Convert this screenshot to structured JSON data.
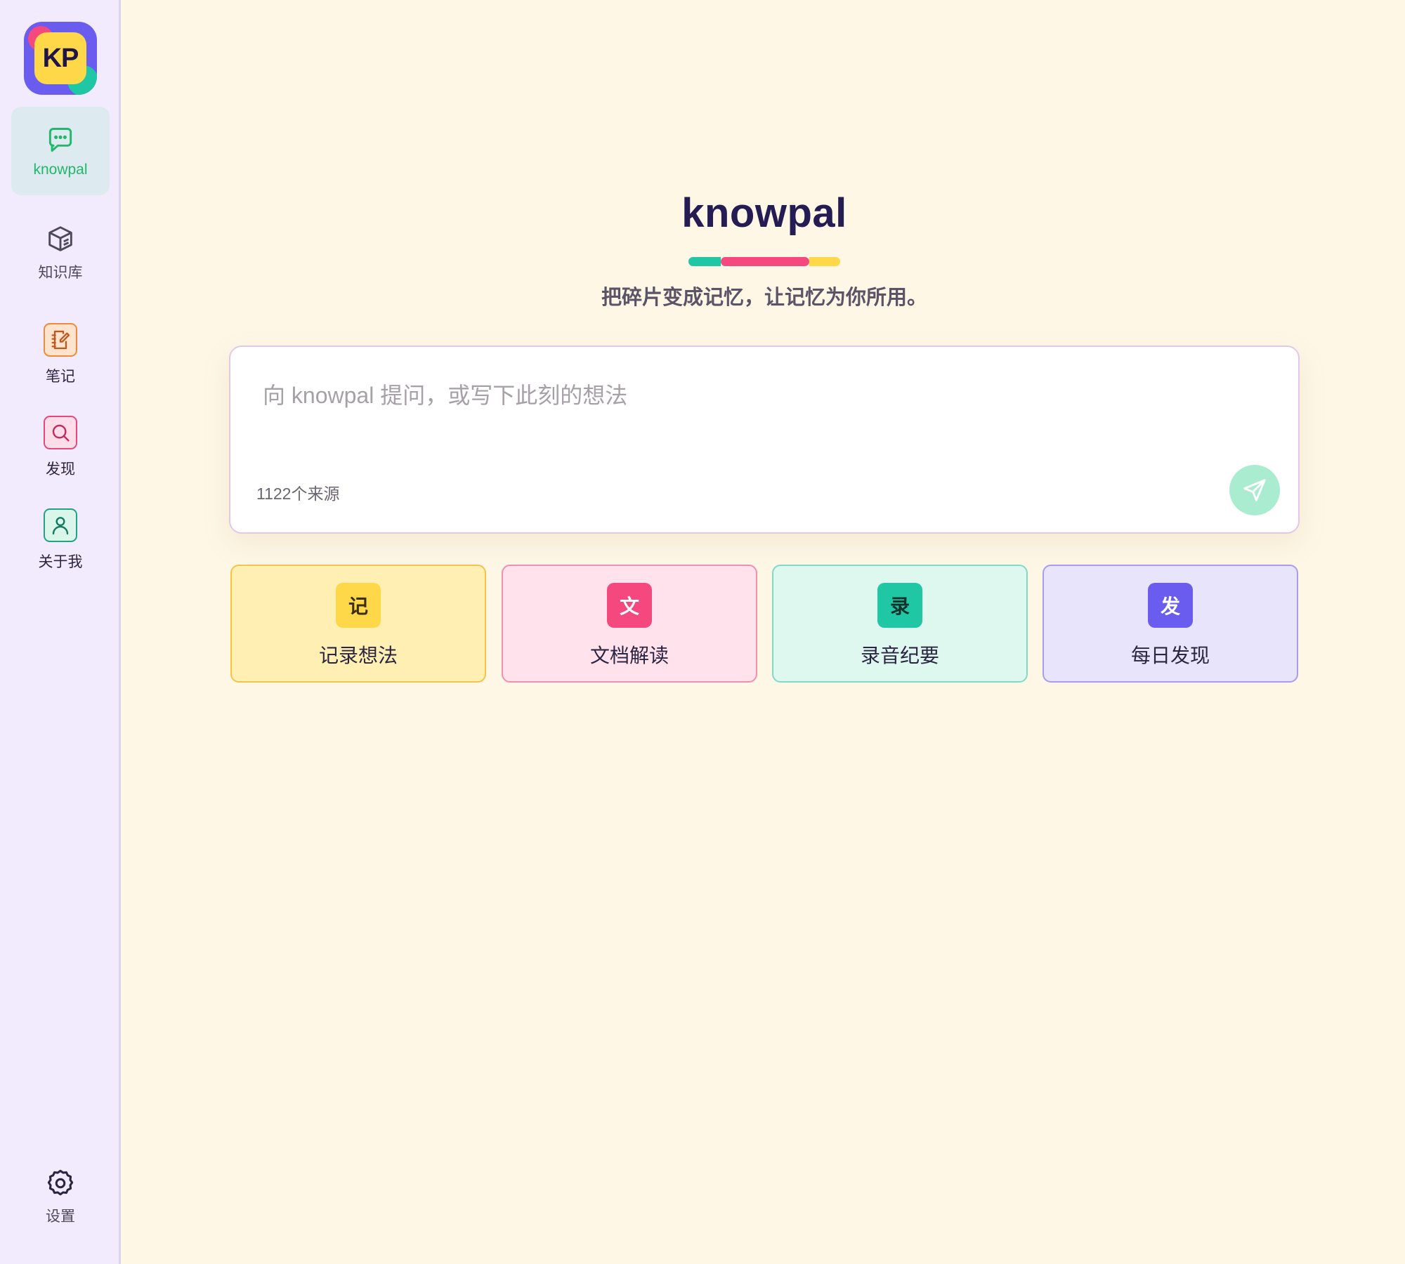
{
  "sidebar": {
    "logo_text": "KP",
    "items": [
      {
        "label": "knowpal",
        "icon": "chat-icon",
        "active": true
      },
      {
        "label": "知识库",
        "icon": "cube-icon"
      },
      {
        "label": "笔记",
        "icon": "note-edit-icon"
      },
      {
        "label": "发现",
        "icon": "search-icon"
      },
      {
        "label": "关于我",
        "icon": "user-icon"
      }
    ],
    "settings": {
      "label": "设置",
      "icon": "gear-icon"
    }
  },
  "main": {
    "title": "knowpal",
    "subtitle": "把碎片变成记忆，让记忆为你所用。",
    "input": {
      "placeholder": "向 knowpal 提问，或写下此刻的想法",
      "sources": "1122个来源",
      "send_icon": "send-icon"
    },
    "actions": [
      {
        "badge": "记",
        "label": "记录想法",
        "color": "#ffd84a"
      },
      {
        "badge": "文",
        "label": "文档解读",
        "color": "#f5487f"
      },
      {
        "badge": "录",
        "label": "录音纪要",
        "color": "#20c7a5"
      },
      {
        "badge": "发",
        "label": "每日发现",
        "color": "#6b5cf0"
      }
    ]
  },
  "colors": {
    "background": "#fef7e6",
    "sidebar": "#f2ebfd",
    "accent_green": "#20b86a",
    "title": "#241c52"
  }
}
